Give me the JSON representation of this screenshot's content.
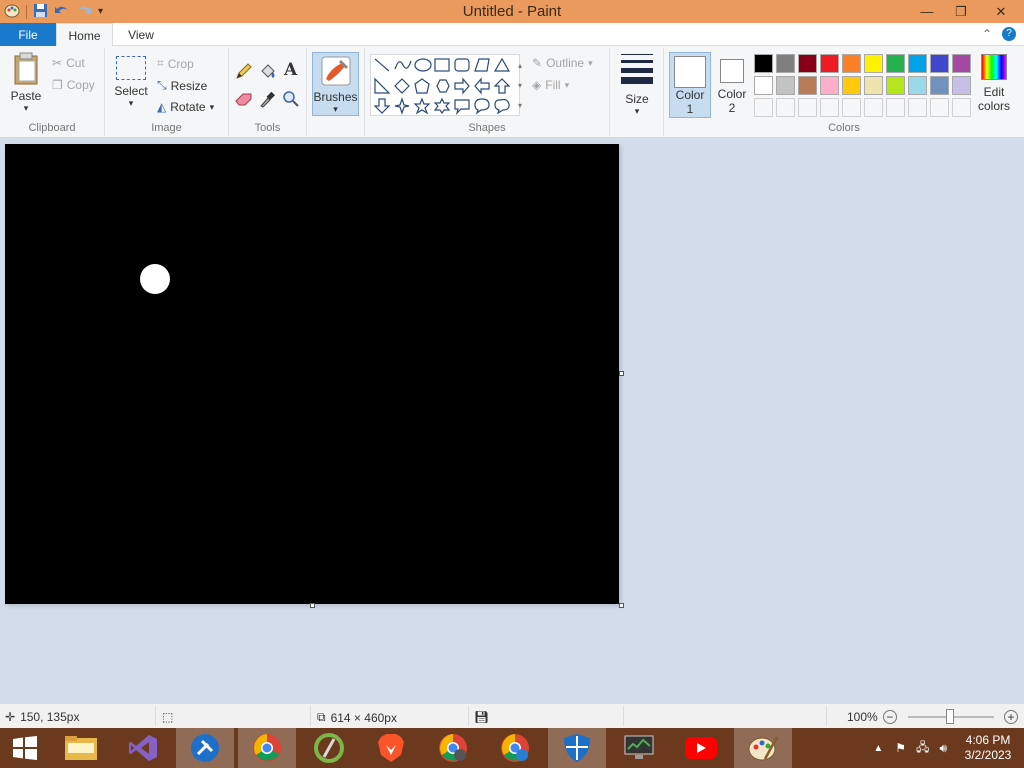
{
  "window": {
    "title": "Untitled - Paint",
    "minimize_icon": "minimize-icon",
    "maximize_icon": "restore-icon",
    "close_icon": "close-icon"
  },
  "tabs": {
    "file": "File",
    "home": "Home",
    "view": "View"
  },
  "clipboard": {
    "paste": "Paste",
    "cut": "Cut",
    "copy": "Copy",
    "label": "Clipboard"
  },
  "image": {
    "select": "Select",
    "crop": "Crop",
    "resize": "Resize",
    "rotate": "Rotate",
    "label": "Image"
  },
  "tools": {
    "label": "Tools"
  },
  "brushes": {
    "label": "Brushes"
  },
  "shapes": {
    "outline": "Outline",
    "fill": "Fill",
    "label": "Shapes"
  },
  "size": {
    "label": "Size"
  },
  "colors": {
    "color1": "Color",
    "color1_num": "1",
    "color2": "Color",
    "color2_num": "2",
    "edit1": "Edit",
    "edit2": "colors",
    "label": "Colors",
    "row1": [
      "#000000",
      "#7f7f7f",
      "#880015",
      "#ed1c24",
      "#ff7f27",
      "#fff200",
      "#22b14c",
      "#00a2e8",
      "#3f48cc",
      "#a349a4"
    ],
    "row2": [
      "#ffffff",
      "#c3c3c3",
      "#b97a57",
      "#ffaec9",
      "#ffc90e",
      "#efe4b0",
      "#b5e61d",
      "#99d9ea",
      "#7092be",
      "#c8bfe7"
    ]
  },
  "status": {
    "cursor_pos": "150, 135px",
    "canvas_size": "614 × 460px",
    "zoom": "100%"
  },
  "clock": {
    "time": "4:06 PM",
    "date": "3/2/2023"
  },
  "canvas_colors": {
    "background": "#000000",
    "dot": "#ffffff"
  }
}
